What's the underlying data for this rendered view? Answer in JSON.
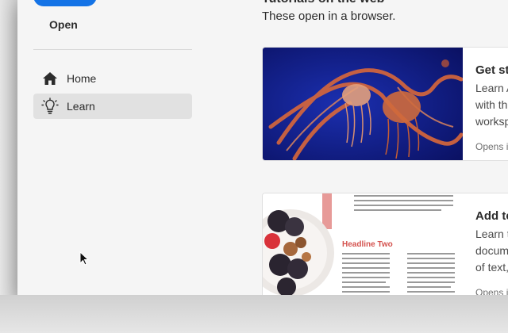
{
  "sidebar": {
    "open_label": "Open",
    "items": [
      {
        "label": "Home",
        "icon": "home-icon"
      },
      {
        "label": "Learn",
        "icon": "lightbulb-icon",
        "selected": true
      }
    ]
  },
  "main": {
    "section_title": "Tutorials on the web",
    "section_subtitle": "These open in a browser.",
    "cards": [
      {
        "title": "Get sta",
        "desc_lines": [
          "Learn A",
          "with th",
          "worksp"
        ],
        "footer": "Opens i"
      },
      {
        "title": "Add te",
        "desc_lines": [
          "Learn th",
          "docum",
          "of text,"
        ],
        "footer": "Opens in",
        "thumb_headline": "Headline Two"
      }
    ]
  },
  "colors": {
    "accent": "#1473e6",
    "selected_bg": "#e1e1e1",
    "headline": "#d4524e"
  }
}
